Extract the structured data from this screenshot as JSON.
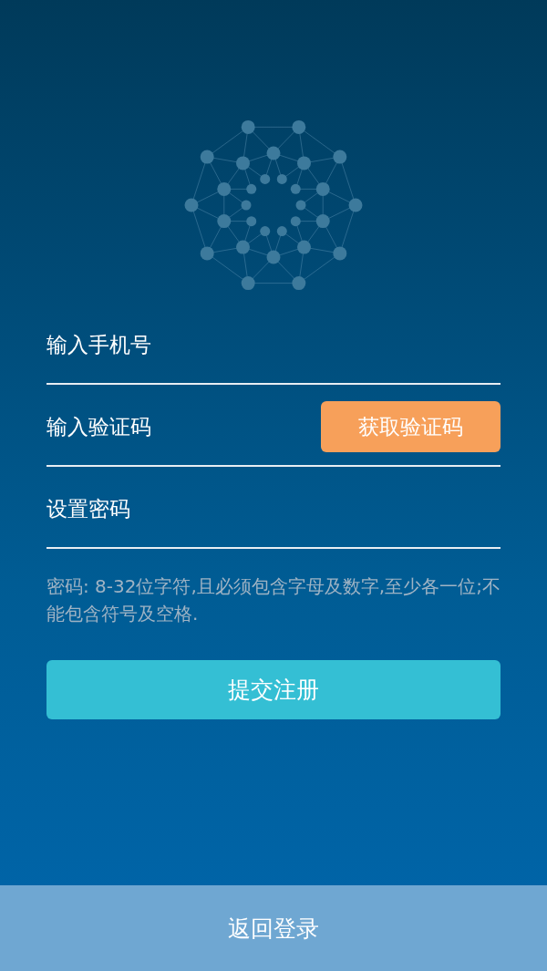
{
  "fields": [
    {
      "placeholder": "输入手机号"
    },
    {
      "placeholder": "输入验证码",
      "action": "获取验证码"
    },
    {
      "placeholder": "设置密码"
    }
  ],
  "hint": "密码: 8-32位字符,且必须包含字母及数字,至少各一位;不能包含符号及空格.",
  "submit": "提交注册",
  "footer_button": "返回登录"
}
